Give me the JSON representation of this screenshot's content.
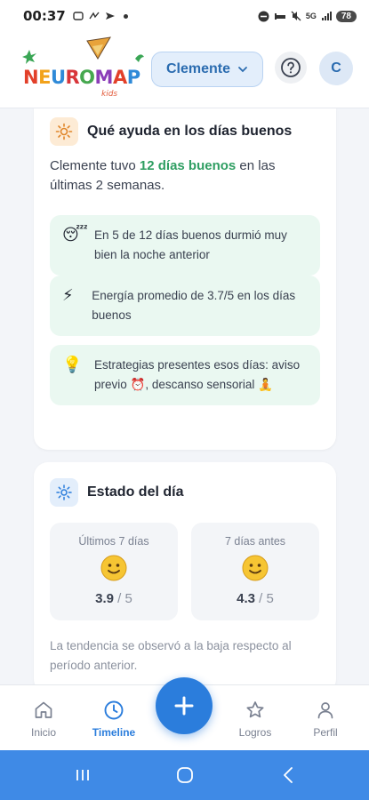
{
  "status_bar": {
    "time": "00:37",
    "battery": "78",
    "signal_label": "5G"
  },
  "header": {
    "logo_text": "NEUROMAP",
    "child_name": "Clemente",
    "avatar_initial": "C"
  },
  "good_days_card": {
    "title": "Qué ayuda en los días buenos",
    "summary_prefix": "Clemente tuvo ",
    "summary_highlight": "12 días buenos",
    "summary_suffix": " en las últimas 2 semanas.",
    "insights": [
      {
        "icon": "sleeping-face-icon",
        "emoji": "😴",
        "text": "En 5 de 12 días buenos durmió muy bien la noche anterior"
      },
      {
        "icon": "lightning-icon",
        "emoji": "⚡",
        "text": "Energía promedio de 3.7/5 en los días buenos"
      },
      {
        "icon": "lightbulb-icon",
        "emoji": "💡",
        "text": "Estrategias presentes esos días: aviso previo ⏰, descanso sensorial 🧘"
      }
    ]
  },
  "day_state_card": {
    "title": "Estado del día",
    "periods": [
      {
        "label": "Últimos 7 días",
        "value": "3.9",
        "max": "/ 5"
      },
      {
        "label": "7 días antes",
        "value": "4.3",
        "max": "/ 5"
      }
    ],
    "trend_note": "La tendencia se observó a la baja respecto al período anterior."
  },
  "bottom_nav": {
    "items": [
      {
        "label": "Inicio",
        "icon": "home-icon"
      },
      {
        "label": "Timeline",
        "icon": "clock-icon",
        "active": true
      },
      {
        "label": "Logros",
        "icon": "star-icon"
      },
      {
        "label": "Perfil",
        "icon": "person-icon"
      }
    ]
  },
  "colors": {
    "primary": "#2b7ddc",
    "positive": "#2f9e62",
    "insight_bg": "#eaf8f1",
    "android_nav": "#3f8ae6"
  }
}
